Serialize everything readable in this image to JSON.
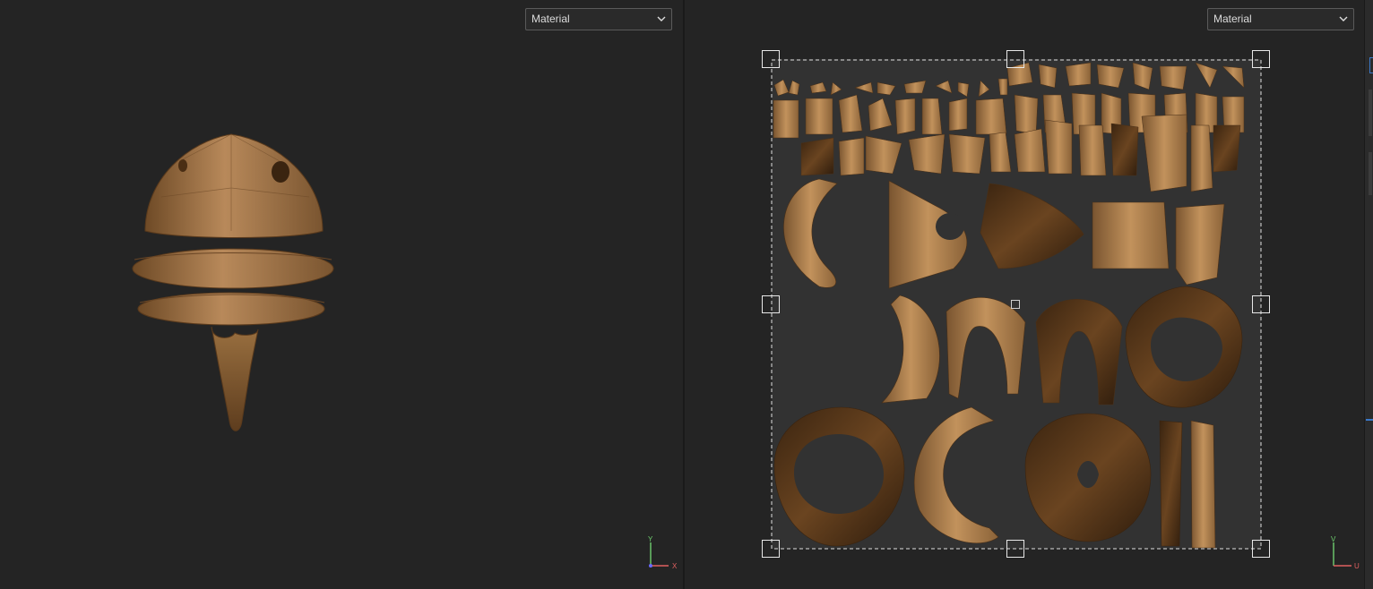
{
  "viewport_3d": {
    "shading_dropdown": {
      "value": "Material"
    },
    "axis_gizmo": {
      "vertical": "Y",
      "horizontal": "X"
    }
  },
  "viewport_uv": {
    "shading_dropdown": {
      "value": "Material"
    },
    "axis_gizmo": {
      "vertical": "V",
      "horizontal": "U"
    }
  },
  "icons": {
    "dropdown": "chevron-down-icon",
    "axes": "axis-gizmo-icon"
  },
  "colors": {
    "background": "#242424",
    "uv_tile": "#323232",
    "wood_light": "#b48550",
    "wood_dark": "#3a2410",
    "axis_y": "#6fcf6f",
    "axis_x": "#e06060",
    "accent": "#3a78c8"
  }
}
